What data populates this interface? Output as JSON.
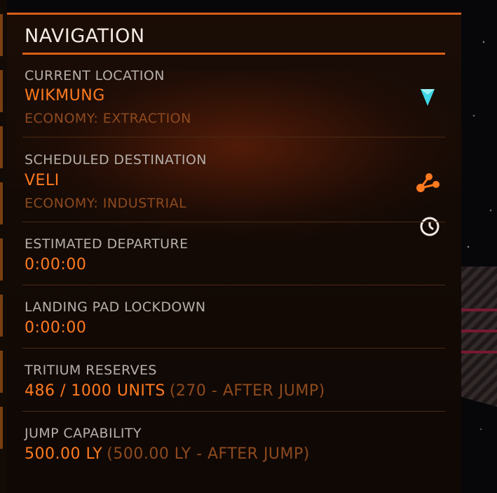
{
  "panel": {
    "title": "NAVIGATION"
  },
  "current_location": {
    "label": "CURRENT LOCATION",
    "value": "WIKMUNG",
    "economy": "ECONOMY: EXTRACTION",
    "icon": "location-marker-icon"
  },
  "scheduled_destination": {
    "label": "SCHEDULED DESTINATION",
    "value": "VELI",
    "economy": "ECONOMY: INDUSTRIAL",
    "icon": "route-icon"
  },
  "estimated_departure": {
    "label": "ESTIMATED DEPARTURE",
    "value": "0:00:00",
    "icon": "clock-icon"
  },
  "landing_pad_lockdown": {
    "label": "LANDING PAD LOCKDOWN",
    "value": "0:00:00"
  },
  "tritium_reserves": {
    "label": "TRITIUM RESERVES",
    "value": "486 / 1000 UNITS",
    "after": "(270 - AFTER JUMP)"
  },
  "jump_capability": {
    "label": "JUMP CAPABILITY",
    "value": "500.00 LY",
    "after": "(500.00 LY - AFTER JUMP)"
  },
  "colors": {
    "accent": "#d9601a",
    "value": "#ff7a1f",
    "label": "#b5afaa",
    "muted": "#8e4a1e",
    "location_icon": "#3fd7e6"
  }
}
